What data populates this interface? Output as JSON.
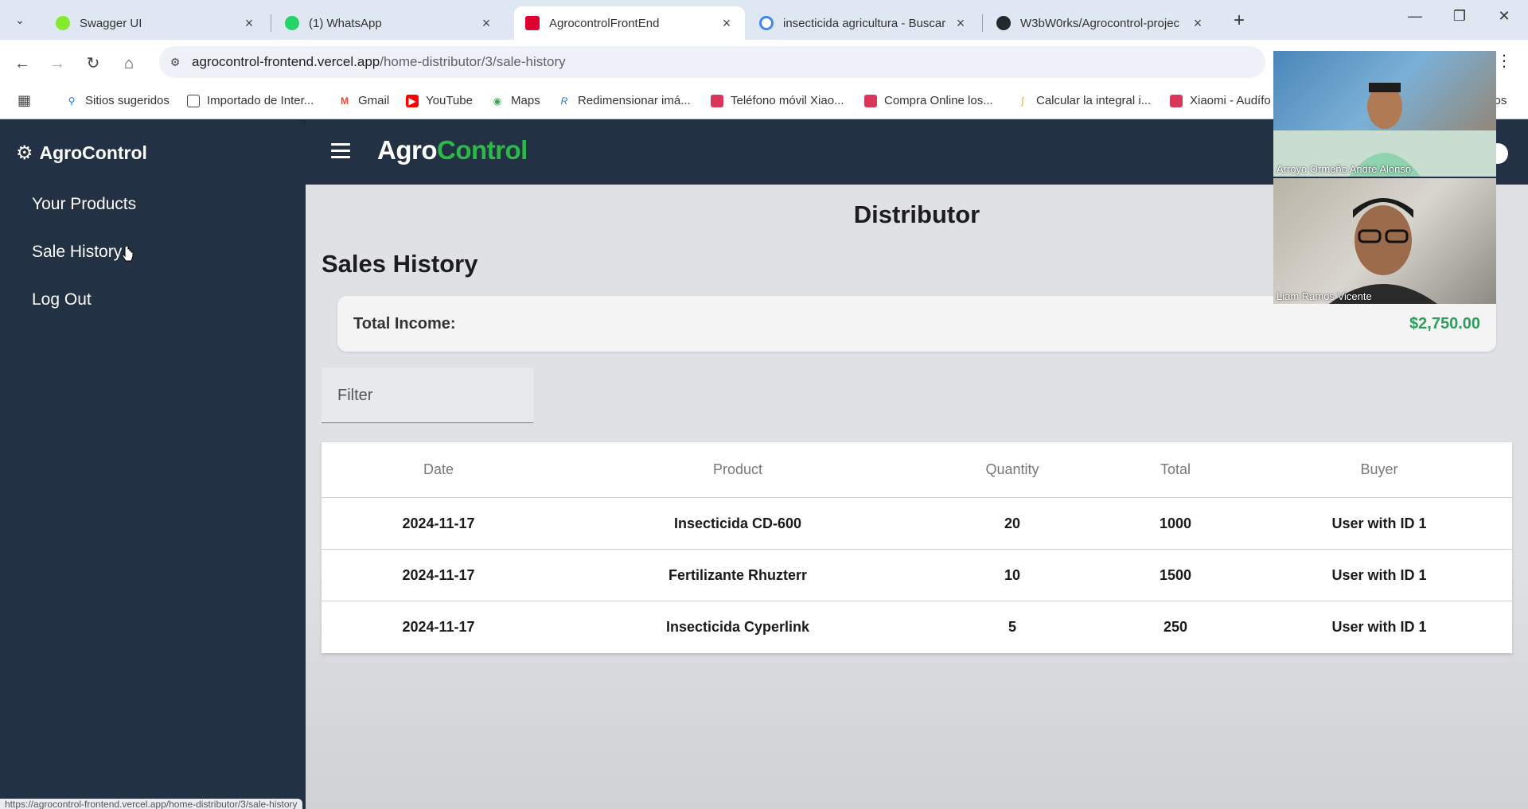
{
  "browser": {
    "tabs": [
      {
        "title": "Swagger UI",
        "icon": "swagger-icon",
        "color": "#85ea2d"
      },
      {
        "title": "(1) WhatsApp",
        "icon": "whatsapp-icon",
        "color": "#25d366"
      },
      {
        "title": "AgrocontrolFrontEnd",
        "icon": "angular-icon",
        "color": "#dd0031"
      },
      {
        "title": "insecticida agricultura - Buscar",
        "icon": "google-icon",
        "color": "#4285f4"
      },
      {
        "title": "W3bW0rks/Agrocontrol-projec",
        "icon": "github-icon",
        "color": "#24292f"
      }
    ],
    "url_host": "agrocontrol-frontend.vercel.app",
    "url_path": "/home-distributor/3/sale-history",
    "bookmarks": [
      "Sitios sugeridos",
      "Importado de Inter...",
      "Gmail",
      "YouTube",
      "Maps",
      "Redimensionar imá...",
      "Teléfono móvil Xiao...",
      "Compra Online los...",
      "Calcular la integral i...",
      "Xiaomi - Audífo",
      "itos"
    ],
    "status_url": "https://agrocontrol-frontend.vercel.app/home-distributor/3/sale-history"
  },
  "sidebar": {
    "logo": "AgroControl",
    "items": [
      "Your Products",
      "Sale History",
      "Log Out"
    ]
  },
  "topbar": {
    "brand_a": "Agro",
    "brand_b": "Control"
  },
  "main": {
    "page_title": "Distributor",
    "section_title": "Sales History",
    "income_label": "Total Income:",
    "income_value": "$2,750.00",
    "filter_placeholder": "Filter"
  },
  "table": {
    "headers": [
      "Date",
      "Product",
      "Quantity",
      "Total",
      "Buyer"
    ],
    "rows": [
      [
        "2024-11-17",
        "Insecticida CD-600",
        "20",
        "1000",
        "User with ID 1"
      ],
      [
        "2024-11-17",
        "Fertilizante Rhuzterr",
        "10",
        "1500",
        "User with ID 1"
      ],
      [
        "2024-11-17",
        "Insecticida Cyperlink",
        "5",
        "250",
        "User with ID 1"
      ]
    ]
  },
  "video_call": {
    "participants": [
      "Arroyo Ormeño André Alonso",
      "Liam Ramos Vicente"
    ]
  },
  "colors": {
    "sidebar": "#223144",
    "brand_green": "#2fb84a",
    "income_green": "#2e9e5b"
  }
}
